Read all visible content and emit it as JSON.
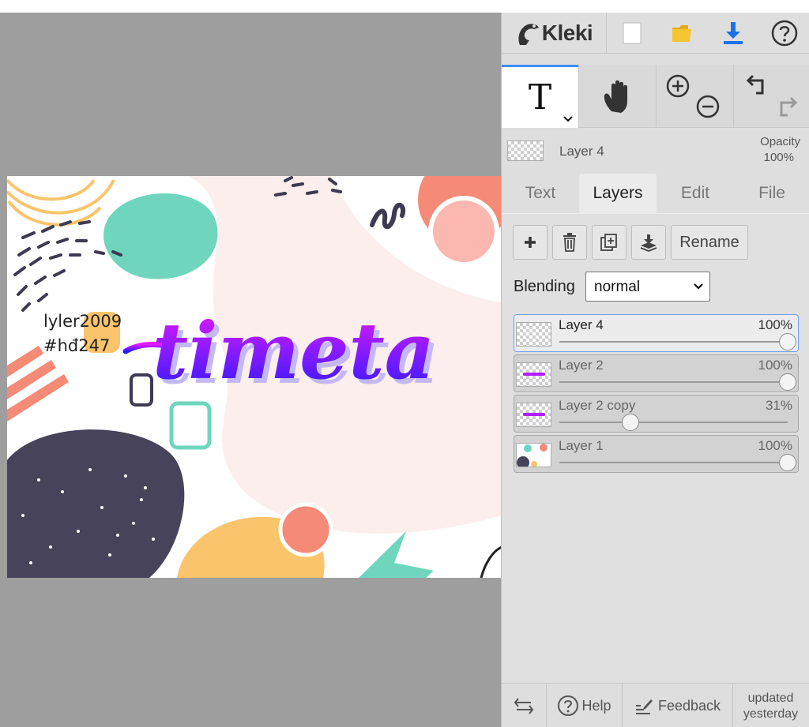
{
  "app": {
    "name": "Kleki"
  },
  "colors": {
    "accent": "#3f8cf2",
    "panel_bg": "#dedede",
    "workspace_bg": "#9e9e9e",
    "brush_gradient_top": "#e619ff",
    "brush_gradient_bottom": "#2b1bff"
  },
  "header": {
    "new_icon": "new-image-icon",
    "open_icon": "folder-open-icon",
    "download_icon": "download-icon",
    "help_icon": "help-circle-icon"
  },
  "tools": {
    "text_tool": "T",
    "hand_tool": "hand-icon",
    "zoom_in": "zoom-in-icon",
    "zoom_out": "zoom-out-icon",
    "undo": "undo-icon",
    "redo": "redo-icon"
  },
  "current_layer": {
    "name": "Layer 4",
    "opacity_label": "Opacity",
    "opacity_value": "100%"
  },
  "tabs": [
    {
      "label": "Text"
    },
    {
      "label": "Layers"
    },
    {
      "label": "Edit"
    },
    {
      "label": "File"
    }
  ],
  "layers_panel": {
    "rename_label": "Rename",
    "blending_label": "Blending",
    "blending_value": "normal",
    "layers": [
      {
        "name": "Layer 4",
        "opacity": "100%",
        "opacity_fraction": 1.0
      },
      {
        "name": "Layer 2",
        "opacity": "100%",
        "opacity_fraction": 1.0
      },
      {
        "name": "Layer 2 copy",
        "opacity": "31%",
        "opacity_fraction": 0.31
      },
      {
        "name": "Layer 1",
        "opacity": "100%",
        "opacity_fraction": 1.0
      }
    ]
  },
  "canvas": {
    "watermark_line1": "lyler2009",
    "watermark_line2": "#hđ247",
    "lettering_text": "timeta"
  },
  "footer": {
    "help_label": "Help",
    "feedback_label": "Feedback",
    "updated_line1": "updated",
    "updated_line2": "yesterday"
  }
}
